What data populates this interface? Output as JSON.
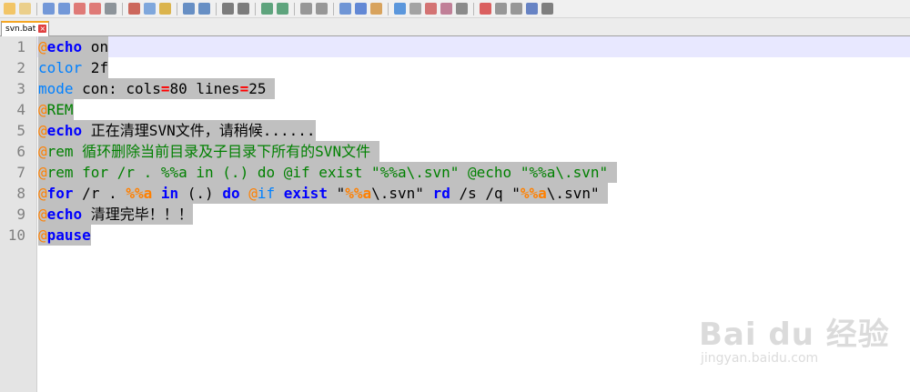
{
  "toolbar": {
    "buttons": [
      "new-file",
      "open-file",
      "save",
      "save-all",
      "close",
      "close-all",
      "print",
      "cut",
      "copy",
      "paste",
      "undo",
      "redo",
      "find",
      "replace",
      "zoom-in",
      "zoom-out",
      "sync-vertical",
      "sync-horizontal",
      "word-wrap",
      "show-all-chars",
      "indent-guide",
      "user-language",
      "doc-map",
      "function-list",
      "folder-as-workspace",
      "monitoring",
      "record-macro",
      "stop-record",
      "play-macro",
      "run-macro-multiple",
      "save-macro"
    ]
  },
  "tab": {
    "label": "svn.bat"
  },
  "editor": {
    "line_numbers": [
      "1",
      "2",
      "3",
      "4",
      "5",
      "6",
      "7",
      "8",
      "9",
      "10"
    ],
    "lines": [
      [
        {
          "t": "@",
          "c": "at"
        },
        {
          "t": "echo",
          "c": "kw"
        },
        {
          "t": " on",
          "c": ""
        }
      ],
      [
        {
          "t": "color",
          "c": "cmd"
        },
        {
          "t": " 2f",
          "c": ""
        }
      ],
      [
        {
          "t": "mode",
          "c": "cmd"
        },
        {
          "t": " con: cols",
          "c": ""
        },
        {
          "t": "=",
          "c": "op"
        },
        {
          "t": "80 lines",
          "c": ""
        },
        {
          "t": "=",
          "c": "op"
        },
        {
          "t": "25 ",
          "c": ""
        }
      ],
      [
        {
          "t": "@",
          "c": "at"
        },
        {
          "t": "REM",
          "c": "cm"
        }
      ],
      [
        {
          "t": "@",
          "c": "at"
        },
        {
          "t": "echo",
          "c": "kw"
        },
        {
          "t": " 正在清理SVN文件，请稍候......",
          "c": ""
        }
      ],
      [
        {
          "t": "@",
          "c": "at"
        },
        {
          "t": "rem 循环删除当前目录及子目录下所有的SVN文件 ",
          "c": "cm"
        }
      ],
      [
        {
          "t": "@",
          "c": "at"
        },
        {
          "t": "rem for /r . %%a in (.) do @if exist \"%%a\\.svn\" @echo \"%%a\\.svn\" ",
          "c": "cm"
        }
      ],
      [
        {
          "t": "@",
          "c": "at"
        },
        {
          "t": "for",
          "c": "kw"
        },
        {
          "t": " /r . ",
          "c": ""
        },
        {
          "t": "%%a",
          "c": "var"
        },
        {
          "t": " ",
          "c": ""
        },
        {
          "t": "in",
          "c": "kw"
        },
        {
          "t": " (.) ",
          "c": ""
        },
        {
          "t": "do",
          "c": "kw"
        },
        {
          "t": " ",
          "c": ""
        },
        {
          "t": "@",
          "c": "at"
        },
        {
          "t": "if",
          "c": "cmd"
        },
        {
          "t": " ",
          "c": ""
        },
        {
          "t": "exist",
          "c": "kw"
        },
        {
          "t": " \"",
          "c": ""
        },
        {
          "t": "%%a",
          "c": "var"
        },
        {
          "t": "\\.svn\" ",
          "c": ""
        },
        {
          "t": "rd",
          "c": "kw"
        },
        {
          "t": " /s /q \"",
          "c": ""
        },
        {
          "t": "%%a",
          "c": "var"
        },
        {
          "t": "\\.svn\" ",
          "c": ""
        }
      ],
      [
        {
          "t": "@",
          "c": "at"
        },
        {
          "t": "echo",
          "c": "kw"
        },
        {
          "t": " 清理完毕！！！",
          "c": ""
        }
      ],
      [
        {
          "t": "@",
          "c": "at"
        },
        {
          "t": "pause",
          "c": "kw"
        }
      ]
    ]
  },
  "watermark": {
    "text": "Bai du 经验",
    "sub": "jingyan.baidu.com"
  },
  "colors": {
    "keyword": "#0000ff",
    "at_sign": "#ff8000",
    "comment": "#008000",
    "command": "#0080ff",
    "operator": "#ff0000",
    "selection": "#c0c0c0",
    "current_line": "#e8e8ff"
  }
}
